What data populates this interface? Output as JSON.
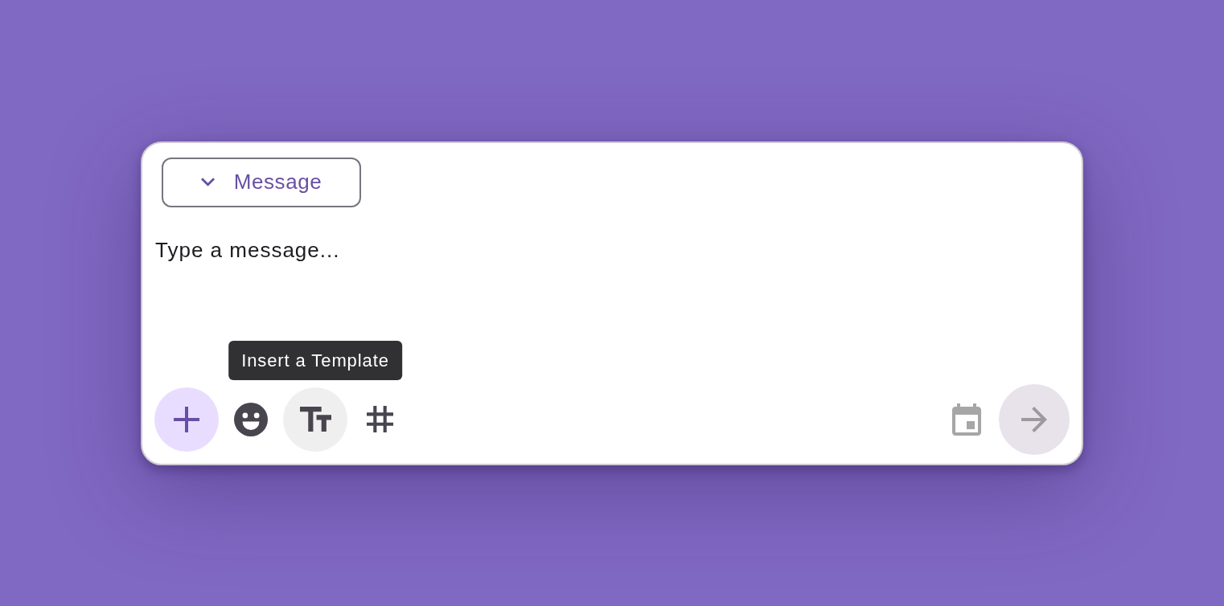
{
  "mode_selector": {
    "label": "Message",
    "expanded": false
  },
  "composer": {
    "placeholder": "Type a message..."
  },
  "toolbar": {
    "buttons": [
      {
        "kind": "add",
        "hovered": false
      },
      {
        "kind": "emoji",
        "hovered": false
      },
      {
        "kind": "template",
        "hovered": true,
        "tooltip": "Insert a Template"
      },
      {
        "kind": "hashtag",
        "hovered": false
      }
    ],
    "schedule": {
      "disabled": true
    },
    "send": {
      "disabled": true
    }
  }
}
